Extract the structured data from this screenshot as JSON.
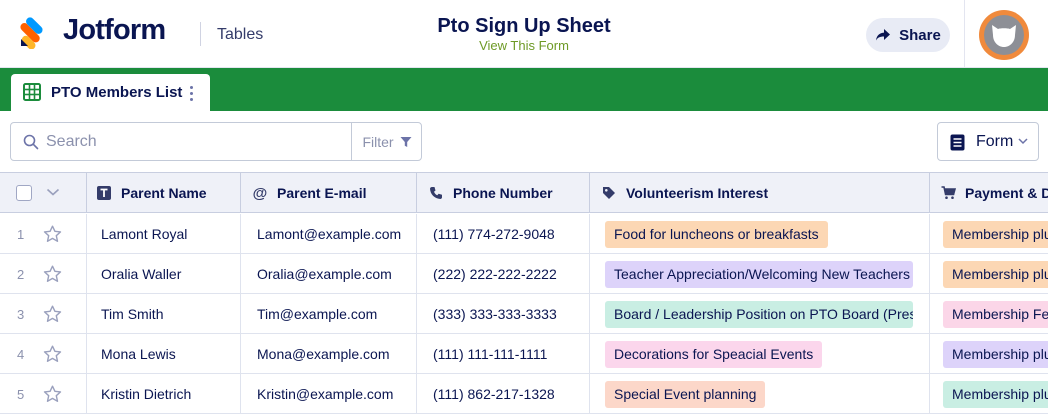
{
  "header": {
    "brand": "Jotform",
    "product": "Tables",
    "form_title": "Pto Sign Up Sheet",
    "form_link": "View This Form",
    "share_label": "Share"
  },
  "tab": {
    "label": "PTO Members List"
  },
  "toolbar": {
    "search_placeholder": "Search",
    "filter_label": "Filter",
    "form_label": "Form"
  },
  "table": {
    "columns": [
      {
        "label": "Parent Name",
        "icon": "text-type-icon"
      },
      {
        "label": "Parent E-mail",
        "icon": "at-sign-icon"
      },
      {
        "label": "Phone Number",
        "icon": "phone-icon"
      },
      {
        "label": "Volunteerism Interest",
        "icon": "tag-icon"
      },
      {
        "label": "Payment & Do",
        "icon": "cart-icon"
      }
    ],
    "rows": [
      {
        "num": "1",
        "name": "Lamont Royal",
        "email": "Lamont@example.com",
        "phone": "(111) 774-272-9048",
        "interest": "Food for luncheons or breakfasts",
        "interest_color": "#fcd7b4",
        "payment": "Membership plu",
        "payment_color": "#fcd7b4"
      },
      {
        "num": "2",
        "name": "Oralia Waller",
        "email": "Oralia@example.com",
        "phone": "(222) 222-222-2222",
        "interest": "Teacher Appreciation/Welcoming New Teachers",
        "interest_color": "#ddd3fa",
        "payment": "Membership plu",
        "payment_color": "#fcd7b4"
      },
      {
        "num": "3",
        "name": "Tim Smith",
        "email": "Tim@example.com",
        "phone": "(333) 333-333-3333",
        "interest": "Board / Leadership Position on PTO Board (Pres,",
        "interest_color": "#c9eee3",
        "payment": "Membership Fee",
        "payment_color": "#fbd6e8"
      },
      {
        "num": "4",
        "name": "Mona Lewis",
        "email": "Mona@example.com",
        "phone": "(111) 111-111-1111",
        "interest": "Decorations for Speacial Events",
        "interest_color": "#fbd6ec",
        "payment": "Membership plu",
        "payment_color": "#ddd3fa"
      },
      {
        "num": "5",
        "name": "Kristin Dietrich",
        "email": "Kristin@example.com",
        "phone": "(111) 862-217-1328",
        "interest": "Special Event planning",
        "interest_color": "#fcd7c9",
        "payment": "Membership plu",
        "payment_color": "#c9eee3"
      }
    ]
  },
  "colors": {
    "brand_green": "#1b8c3c",
    "text_navy": "#0a1551",
    "link_green": "#6e9a26",
    "avatar_orange": "#f08a3c"
  }
}
